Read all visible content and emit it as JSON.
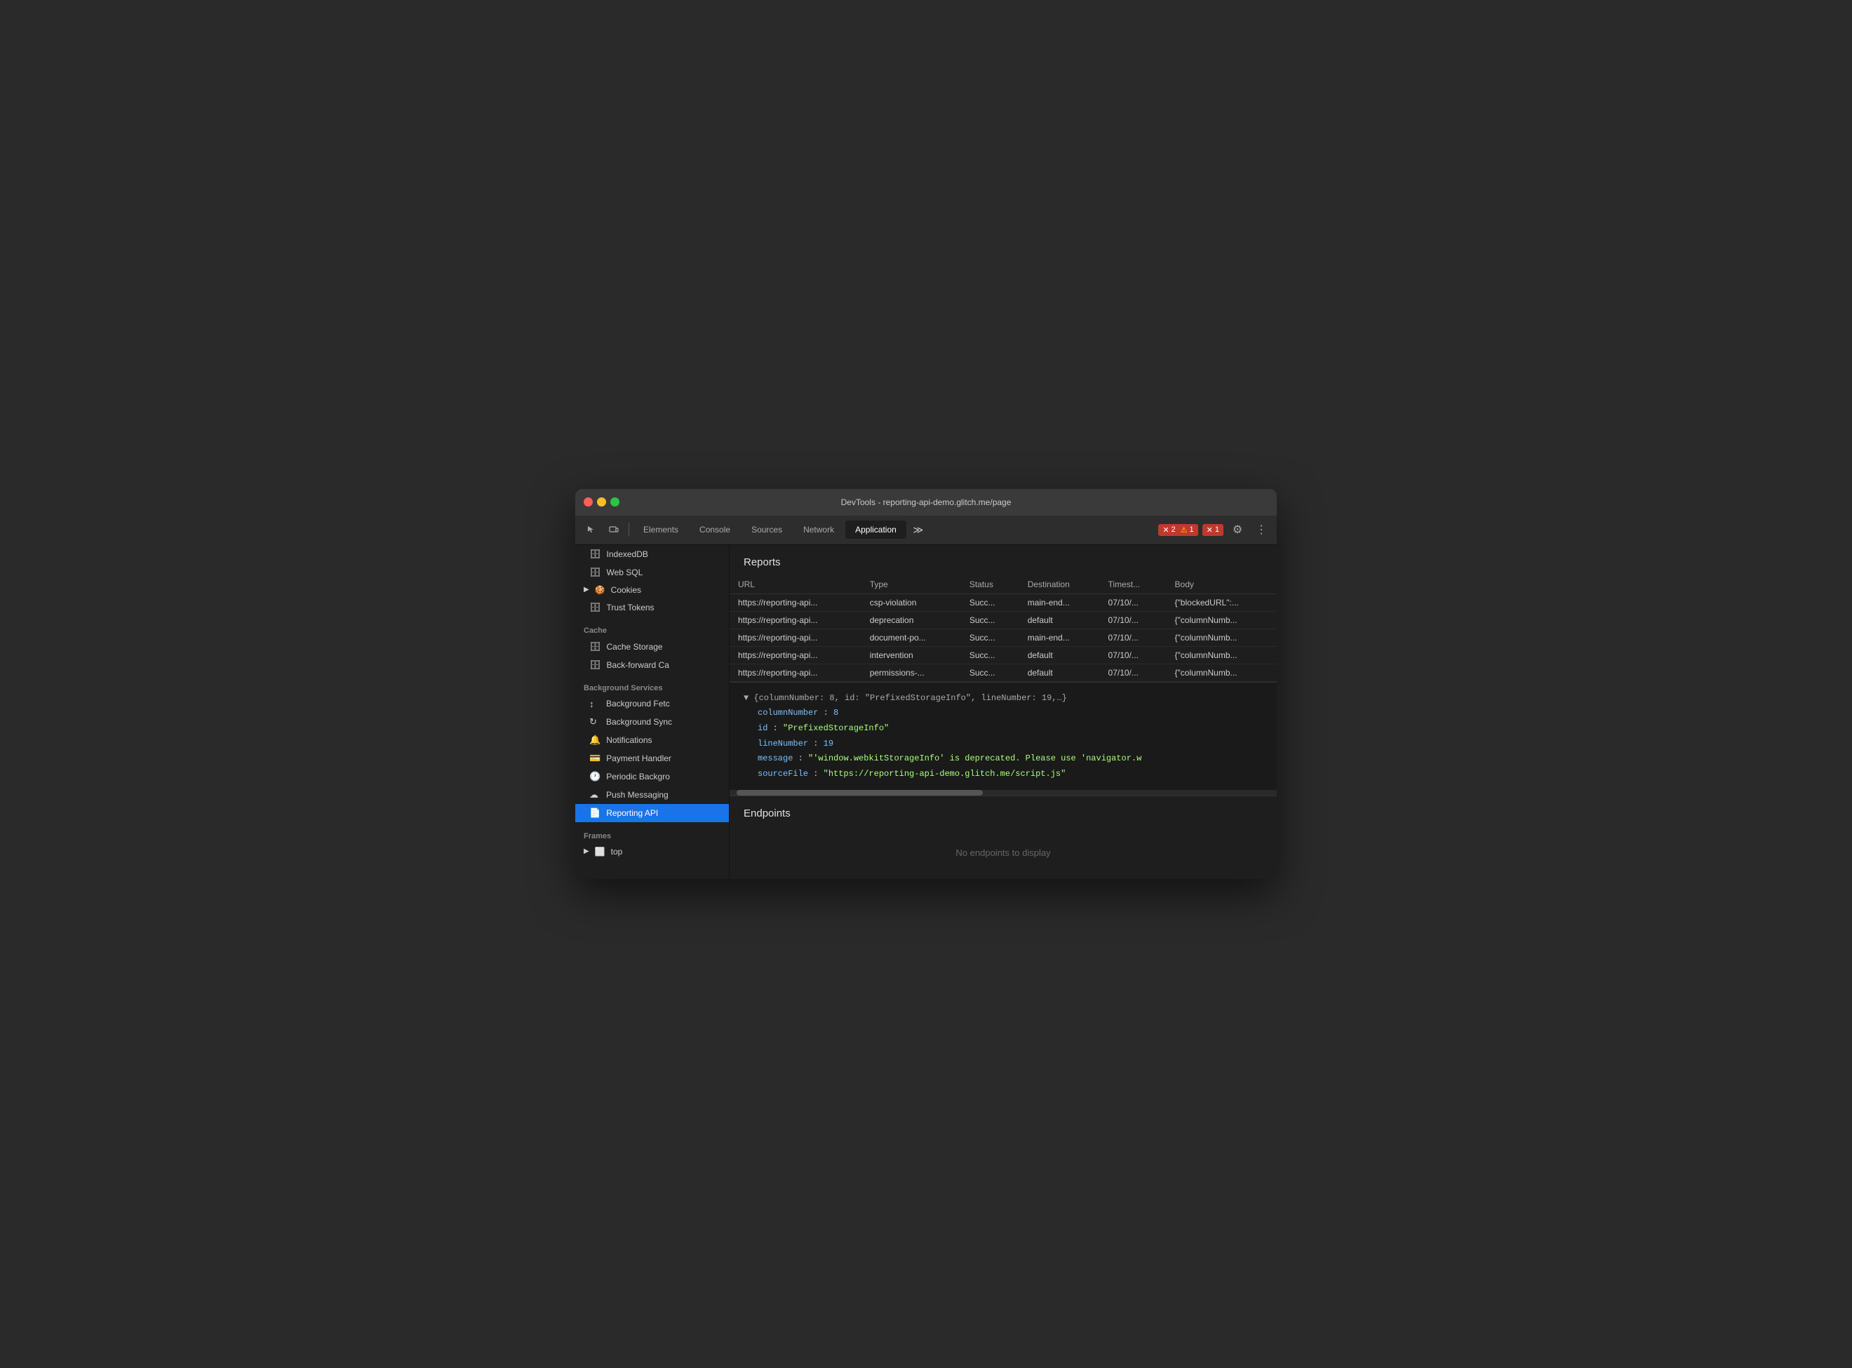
{
  "titlebar": {
    "title": "DevTools - reporting-api-demo.glitch.me/page"
  },
  "toolbar": {
    "tabs": [
      {
        "label": "Elements",
        "active": false
      },
      {
        "label": "Console",
        "active": false
      },
      {
        "label": "Sources",
        "active": false
      },
      {
        "label": "Network",
        "active": false
      },
      {
        "label": "Application",
        "active": true
      }
    ],
    "more_tabs": "≫",
    "error_count": "2",
    "warning_count": "1",
    "info_count": "1",
    "settings_icon": "⚙",
    "more_icon": "⋮"
  },
  "sidebar": {
    "items_top": [
      {
        "label": "IndexedDB",
        "icon": "🗄"
      },
      {
        "label": "Web SQL",
        "icon": "🗄"
      },
      {
        "label": "Cookies",
        "icon": "🍪",
        "expandable": true
      },
      {
        "label": "Trust Tokens",
        "icon": "🗄"
      }
    ],
    "cache_section": "Cache",
    "cache_items": [
      {
        "label": "Cache Storage",
        "icon": "🗄"
      },
      {
        "label": "Back-forward Ca",
        "icon": "🗄"
      }
    ],
    "bg_section": "Background Services",
    "bg_items": [
      {
        "label": "Background Fetc",
        "icon": "↕"
      },
      {
        "label": "Background Sync",
        "icon": "↻"
      },
      {
        "label": "Notifications",
        "icon": "🔔"
      },
      {
        "label": "Payment Handler",
        "icon": "💳"
      },
      {
        "label": "Periodic Backgro",
        "icon": "🕐"
      },
      {
        "label": "Push Messaging",
        "icon": "☁"
      },
      {
        "label": "Reporting API",
        "icon": "📄",
        "active": true
      }
    ],
    "frames_section": "Frames",
    "frames_items": [
      {
        "label": "top",
        "icon": "⬜",
        "expandable": true
      }
    ]
  },
  "reports": {
    "title": "Reports",
    "columns": [
      "URL",
      "Type",
      "Status",
      "Destination",
      "Timest...",
      "Body"
    ],
    "rows": [
      {
        "url": "https://reporting-api...",
        "type": "csp-violation",
        "status": "Succ...",
        "destination": "main-end...",
        "timestamp": "07/10/...",
        "body": "{\"blockedURL\":..."
      },
      {
        "url": "https://reporting-api...",
        "type": "deprecation",
        "status": "Succ...",
        "destination": "default",
        "timestamp": "07/10/...",
        "body": "{\"columnNumb..."
      },
      {
        "url": "https://reporting-api...",
        "type": "document-po...",
        "status": "Succ...",
        "destination": "main-end...",
        "timestamp": "07/10/...",
        "body": "{\"columnNumb..."
      },
      {
        "url": "https://reporting-api...",
        "type": "intervention",
        "status": "Succ...",
        "destination": "default",
        "timestamp": "07/10/...",
        "body": "{\"columnNumb..."
      },
      {
        "url": "https://reporting-api...",
        "type": "permissions-...",
        "status": "Succ...",
        "destination": "default",
        "timestamp": "07/10/...",
        "body": "{\"columnNumb..."
      }
    ]
  },
  "detail": {
    "summary": "▼ {columnNumber: 8, id: \"PrefixedStorageInfo\", lineNumber: 19,…}",
    "fields": [
      {
        "key": "columnNumber",
        "value": "8",
        "type": "number"
      },
      {
        "key": "id",
        "value": "\"PrefixedStorageInfo\"",
        "type": "string"
      },
      {
        "key": "lineNumber",
        "value": "19",
        "type": "number"
      },
      {
        "key": "message",
        "value": "\"'window.webkitStorageInfo' is deprecated. Please use 'navigator.w",
        "type": "string"
      },
      {
        "key": "sourceFile",
        "value": "\"https://reporting-api-demo.glitch.me/script.js\"",
        "type": "string"
      }
    ]
  },
  "endpoints": {
    "title": "Endpoints",
    "empty_message": "No endpoints to display"
  }
}
